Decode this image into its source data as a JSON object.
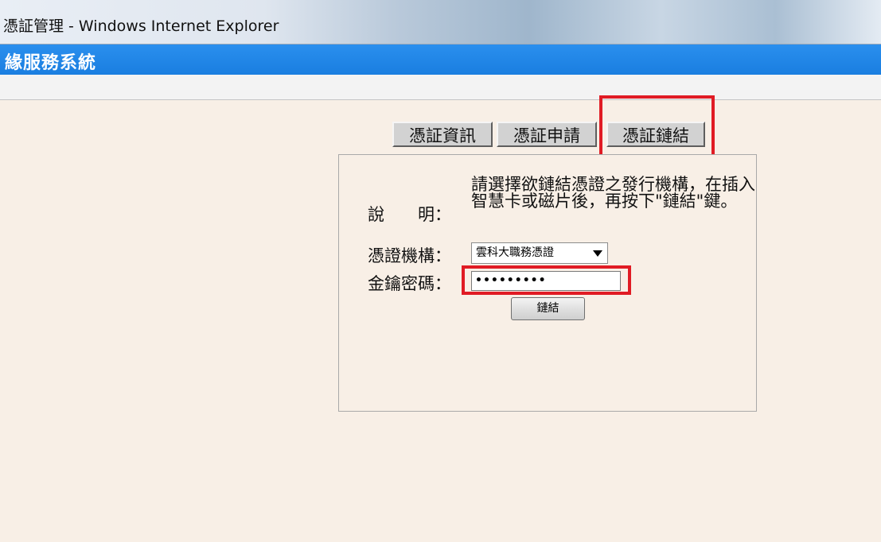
{
  "window": {
    "title": "憑証管理 - Windows Internet Explorer"
  },
  "header": {
    "system_name": "緣服務系統"
  },
  "tabs": [
    {
      "label": "憑証資訊"
    },
    {
      "label": "憑証申請"
    },
    {
      "label": "憑証鏈結"
    }
  ],
  "form": {
    "description_label": "說　　明：",
    "description_text": "請選擇欲鏈結憑證之發行機構，在插入智慧卡或磁片後，再按下\"鏈結\"鍵。",
    "issuer_label": "憑證機構：",
    "issuer_value": "雲科大職務憑證",
    "password_label": "金鑰密碼：",
    "password_value": "•••••••••",
    "link_button_label": "鏈結"
  },
  "colors": {
    "highlight": "#e01b24",
    "header_blue": "#1f86e8",
    "background": "#f8efe6"
  }
}
